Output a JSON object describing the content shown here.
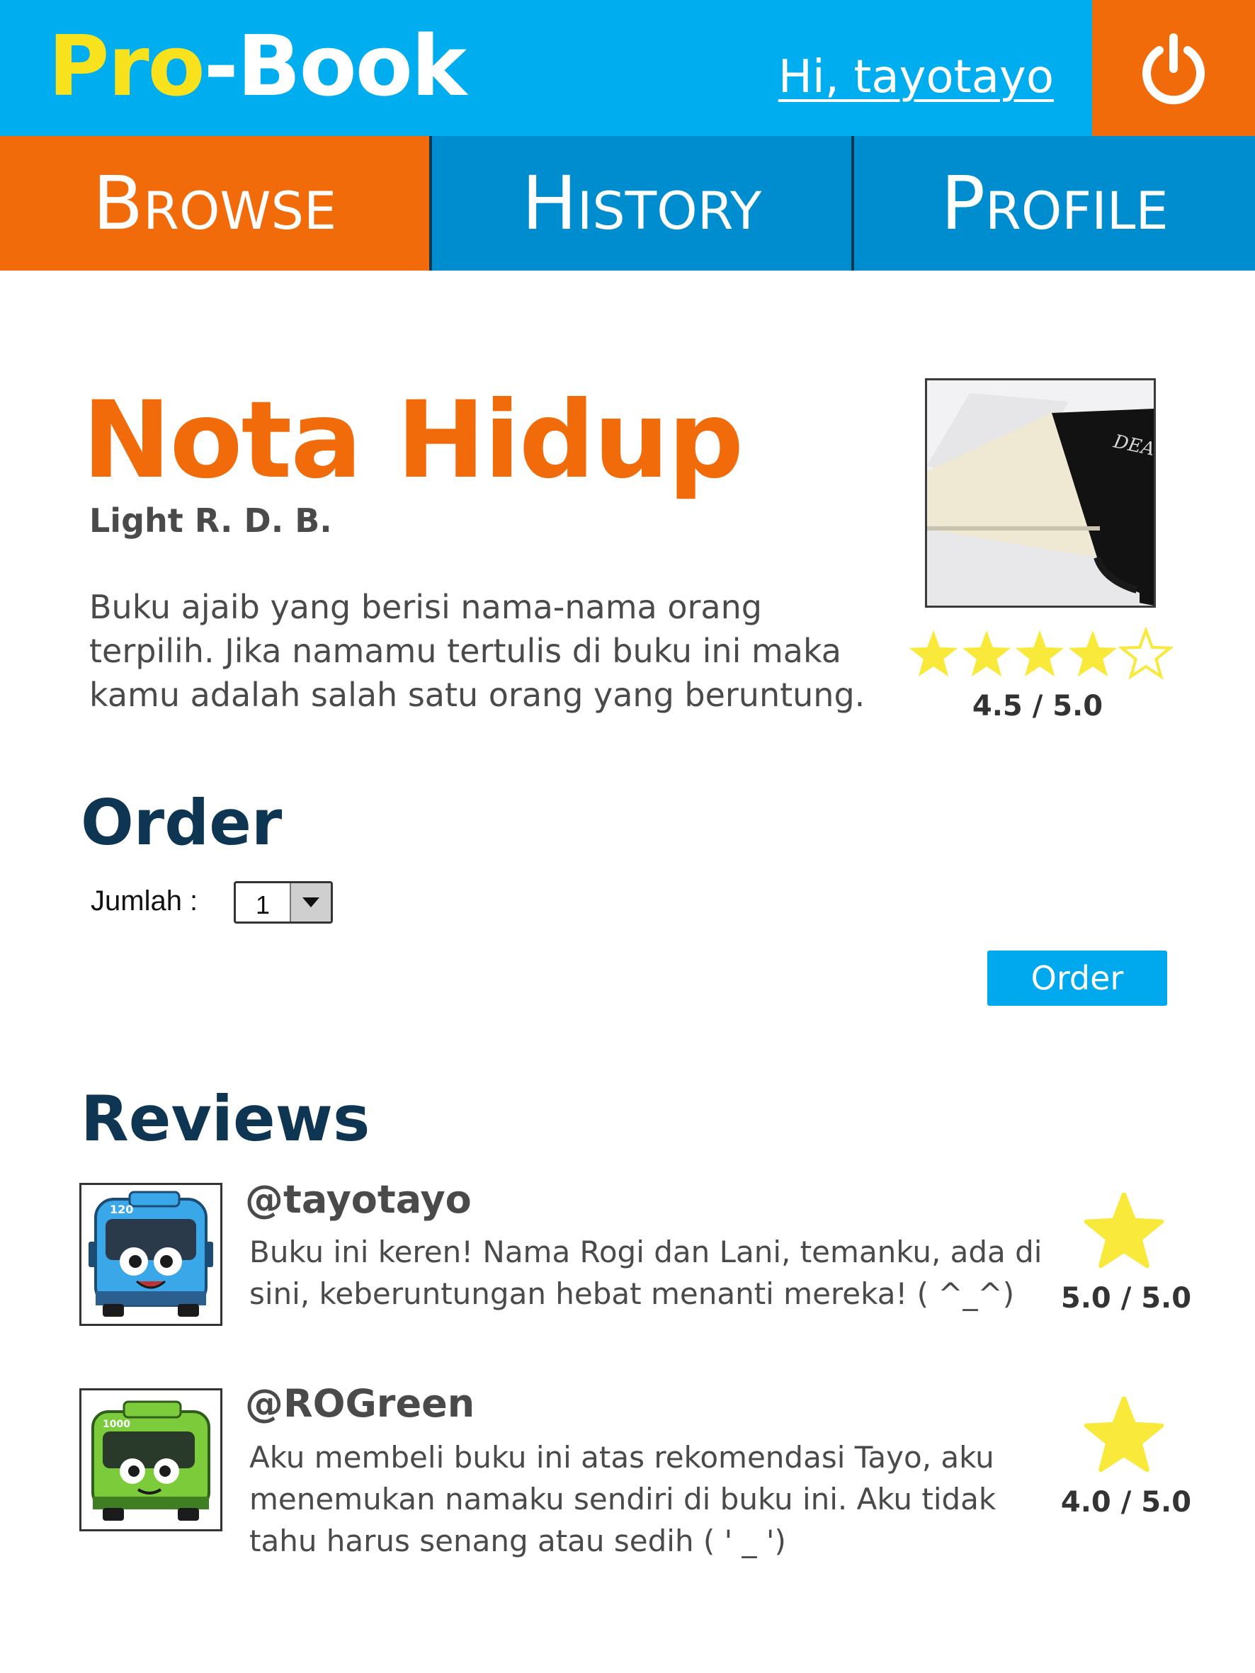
{
  "header": {
    "logo": {
      "part1": "Pro",
      "part2": "-",
      "part3": "Book"
    },
    "greeting": "Hi, tayotayo",
    "logout_icon": "power-icon"
  },
  "nav": {
    "tabs": [
      {
        "label": "Browse",
        "active": true
      },
      {
        "label": "History",
        "active": false
      },
      {
        "label": "Profile",
        "active": false
      }
    ]
  },
  "book": {
    "title": "Nota Hidup",
    "author": "Light R. D. B.",
    "description": "Buku ajaib yang berisi nama-nama orang terpilih. Jika namamu tertulis di buku ini maka kamu adalah salah satu orang yang beruntung.",
    "cover_text": "DEATH",
    "stars": 4,
    "star_max": 5,
    "rating": "4.5 / 5.0"
  },
  "order": {
    "heading": "Order",
    "quantity_label": "Jumlah :",
    "quantity_value": "1",
    "button_label": "Order"
  },
  "reviews": {
    "heading": "Reviews",
    "items": [
      {
        "username": "@tayotayo",
        "text": "Buku ini keren! Nama Rogi dan Lani, temanku, ada di sini, keberuntungan hebat menanti mereka! (  ^_^)",
        "rating": "5.0 / 5.0",
        "bus_color": "#3aa7e8",
        "bus_number": "120"
      },
      {
        "username": "@ROGreen",
        "text": "Aku membeli buku ini atas rekomendasi Tayo, aku menemukan namaku sendiri di buku ini. Aku tidak tahu harus senang atau sedih (    ' _ ')",
        "rating": "4.0 / 5.0",
        "bus_color": "#7ccb3a",
        "bus_number": "1000"
      }
    ]
  },
  "colors": {
    "header_blue": "#00adef",
    "nav_blue": "#008dcf",
    "accent_orange": "#f26b0b",
    "logo_yellow": "#f7e21d",
    "star_yellow": "#f9e93a",
    "heading_navy": "#0e3552"
  }
}
